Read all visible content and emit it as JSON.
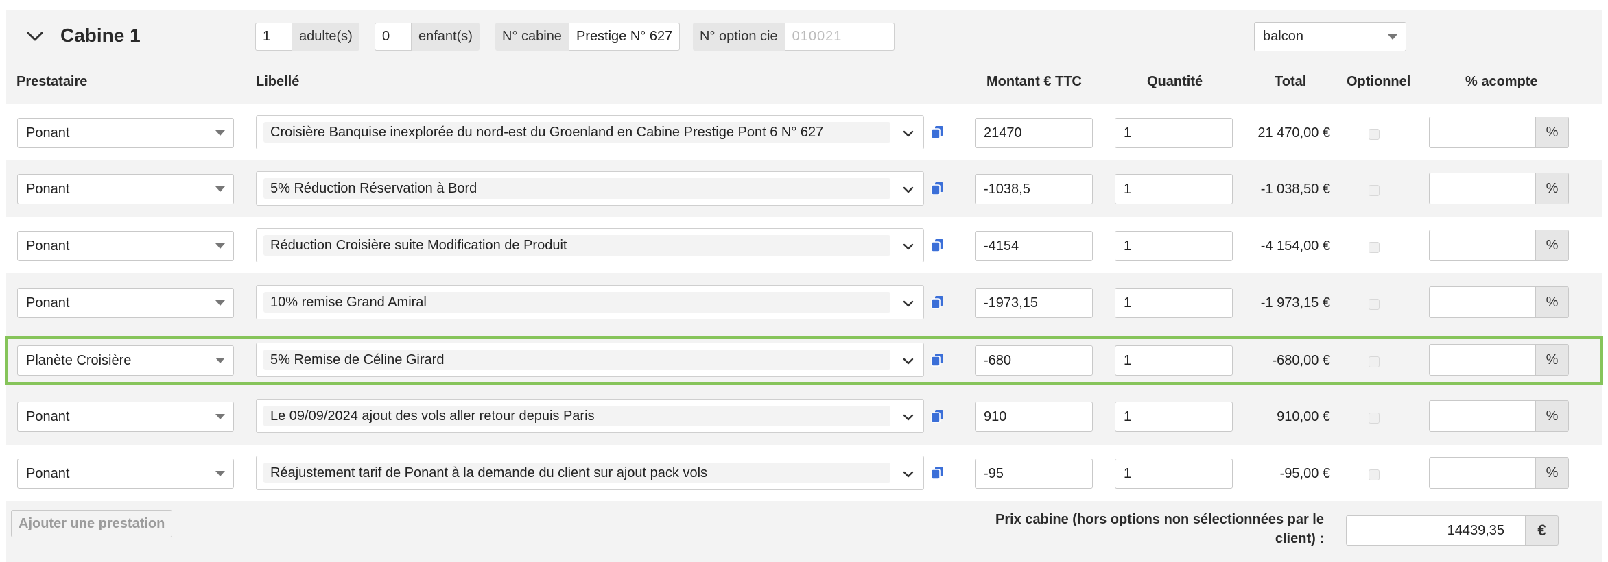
{
  "header": {
    "title": "Cabine 1",
    "adultes": {
      "value": "1",
      "label": "adulte(s)"
    },
    "enfants": {
      "value": "0",
      "label": "enfant(s)"
    },
    "cabine": {
      "label": "N° cabine",
      "value": "Prestige N° 627"
    },
    "option": {
      "label": "N° option cie",
      "value": "010021"
    },
    "category_select": "balcon"
  },
  "columns": {
    "prestataire": "Prestataire",
    "libelle": "Libellé",
    "montant": "Montant € TTC",
    "quantite": "Quantité",
    "total": "Total",
    "optionnel": "Optionnel",
    "acompte": "% acompte"
  },
  "rows": [
    {
      "prestataire": "Ponant",
      "libelle": "Croisière Banquise inexplorée du nord-est du Groenland en Cabine Prestige Pont 6 N° 627",
      "montant": "21470",
      "quantite": "1",
      "total": "21 470,00 €",
      "pct": "%"
    },
    {
      "prestataire": "Ponant",
      "libelle": "5% Réduction Réservation à Bord",
      "montant": "-1038,5",
      "quantite": "1",
      "total": "-1 038,50 €",
      "pct": "%"
    },
    {
      "prestataire": "Ponant",
      "libelle": "Réduction Croisière suite Modification de Produit",
      "montant": "-4154",
      "quantite": "1",
      "total": "-4 154,00 €",
      "pct": "%"
    },
    {
      "prestataire": "Ponant",
      "libelle": "10% remise Grand Amiral",
      "montant": "-1973,15",
      "quantite": "1",
      "total": "-1 973,15 €",
      "pct": "%"
    },
    {
      "prestataire": "Planète Croisière",
      "libelle": "5% Remise de Céline Girard",
      "montant": "-680",
      "quantite": "1",
      "total": "-680,00 €",
      "pct": "%"
    },
    {
      "prestataire": "Ponant",
      "libelle": "Le 09/09/2024 ajout des vols aller retour depuis Paris",
      "montant": "910",
      "quantite": "1",
      "total": "910,00 €",
      "pct": "%"
    },
    {
      "prestataire": "Ponant",
      "libelle": "Réajustement tarif de Ponant à la demande du client sur ajout pack vols",
      "montant": "-95",
      "quantite": "1",
      "total": "-95,00 €",
      "pct": "%"
    }
  ],
  "footer": {
    "add_label": "Ajouter une prestation",
    "prix_label_line1": "Prix cabine (hors options non sélectionnées par le",
    "prix_label_line2": "client) :",
    "prix_value": "14439,35",
    "currency": "€"
  },
  "colors": {
    "highlight_border": "#86c45a",
    "copy_icon": "#3b6fd8"
  },
  "highlighted_row": 4
}
